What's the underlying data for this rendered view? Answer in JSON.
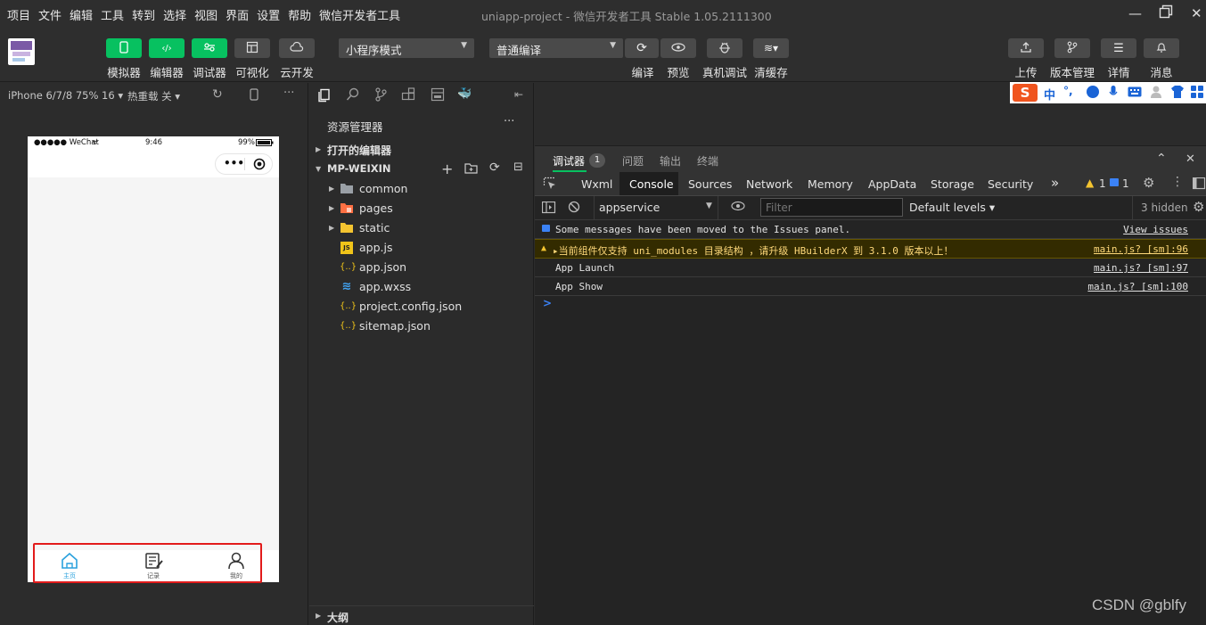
{
  "menubar": {
    "items": [
      "项目",
      "文件",
      "编辑",
      "工具",
      "转到",
      "选择",
      "视图",
      "界面",
      "设置",
      "帮助",
      "微信开发者工具"
    ],
    "window_title": "uniapp-project - 微信开发者工具 Stable 1.05.2111300"
  },
  "toolbar": {
    "buttons": [
      {
        "label": "模拟器",
        "icon": "phone-icon"
      },
      {
        "label": "编辑器",
        "icon": "code-icon"
      },
      {
        "label": "调试器",
        "icon": "debug-icon"
      },
      {
        "label": "可视化",
        "icon": "layout-icon"
      },
      {
        "label": "云开发",
        "icon": "cloud-icon"
      }
    ],
    "mode_select": "小程序模式",
    "compile_select": "普通编译",
    "actions": [
      {
        "label": "编译",
        "icon": "refresh-icon"
      },
      {
        "label": "预览",
        "icon": "eye-icon"
      },
      {
        "label": "真机调试",
        "icon": "bug-icon"
      },
      {
        "label": "清缓存",
        "icon": "layers-icon"
      }
    ],
    "right_actions": [
      {
        "label": "上传",
        "icon": "upload-icon"
      },
      {
        "label": "版本管理",
        "icon": "branch-icon"
      },
      {
        "label": "详情",
        "icon": "menu-icon"
      },
      {
        "label": "消息",
        "icon": "bell-icon"
      }
    ]
  },
  "simulator": {
    "device": "iPhone 6/7/8 75% 16",
    "hot_reload": "热重载 关",
    "status_left": "●●●●● WeChat",
    "status_time": "9:46",
    "status_battery": "99%",
    "tabs": [
      {
        "label": "主页",
        "icon": "home-icon",
        "active": true
      },
      {
        "label": "记录",
        "icon": "notebook-icon",
        "active": false
      },
      {
        "label": "我的",
        "icon": "user-icon",
        "active": false
      }
    ]
  },
  "explorer": {
    "title": "资源管理器",
    "more": "···",
    "open_editors": "打开的编辑器",
    "project": "MP-WEIXIN",
    "files": [
      {
        "name": "common",
        "type": "folder",
        "icon": "folder-icon",
        "color": "#9aa0a6"
      },
      {
        "name": "pages",
        "type": "folder",
        "icon": "folder-pages-icon",
        "color": "#ff7043"
      },
      {
        "name": "static",
        "type": "folder",
        "icon": "folder-static-icon",
        "color": "#f4c430"
      },
      {
        "name": "app.js",
        "type": "file",
        "icon": "js-icon",
        "color": "#f0c419"
      },
      {
        "name": "app.json",
        "type": "file",
        "icon": "json-icon",
        "color": "#f0c419"
      },
      {
        "name": "app.wxss",
        "type": "file",
        "icon": "css-icon",
        "color": "#42a5f5"
      },
      {
        "name": "project.config.json",
        "type": "file",
        "icon": "json-icon",
        "color": "#f0c419"
      },
      {
        "name": "sitemap.json",
        "type": "file",
        "icon": "json-icon",
        "color": "#f0c419"
      }
    ],
    "outline": "大纲"
  },
  "devtools": {
    "top_tabs": [
      {
        "label": "调试器",
        "badge": "1"
      },
      {
        "label": "问题"
      },
      {
        "label": "输出"
      },
      {
        "label": "终端"
      }
    ],
    "tabs": [
      "Wxml",
      "Console",
      "Sources",
      "Network",
      "Memory",
      "AppData",
      "Storage",
      "Security"
    ],
    "active_tab": "Console",
    "more_tabs": "»",
    "warn_count": "1",
    "info_count": "1",
    "context": "appservice",
    "filter_placeholder": "Filter",
    "levels": "Default levels",
    "hidden": "3 hidden",
    "messages": [
      {
        "level": "info",
        "text": "Some messages have been moved to the Issues panel.",
        "source": "View issues"
      },
      {
        "level": "warn",
        "text": "▸当前组件仅支持 uni_modules 目录结构 ，请升级 HBuilderX 到 3.1.0 版本以上！",
        "source": "main.js? [sm]:96"
      },
      {
        "level": "log",
        "text": "App Launch",
        "source": "main.js? [sm]:97"
      },
      {
        "level": "log",
        "text": "App Show",
        "source": "main.js? [sm]:100"
      }
    ],
    "prompt": ">"
  },
  "ime_bar": {
    "logo": "S",
    "mode": "中",
    "punct": "°,"
  },
  "watermark": "CSDN @gblfy",
  "colors": {
    "accent_green": "#07c160",
    "tab_active": "#2aa1dd",
    "highlight_red": "#e21b1b",
    "warn_bg": "#332b00"
  }
}
